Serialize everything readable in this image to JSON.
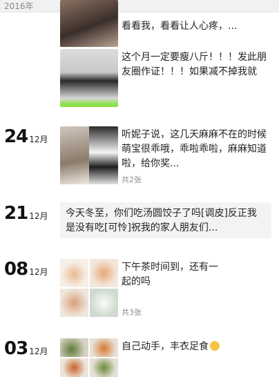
{
  "header": {
    "year": "2016年"
  },
  "posts": [
    {
      "text": "看看我，看看让人心疼，..."
    },
    {
      "text": "这个月一定要瘦八斤！！！发此朋友圈作证！！！如果减不掉我就"
    },
    {
      "day": "24",
      "month": "12月",
      "text": "听妮子说，这几天麻麻不在的时候萌宝很乖哦，乖啦乖啦，麻麻知道啦，给你奖...",
      "count": "共2张"
    },
    {
      "day": "21",
      "month": "12月",
      "text": "今天冬至，你们吃汤圆饺子了吗[调皮]反正我是没有吃[可怜]祝我的家人朋友们..."
    },
    {
      "day": "08",
      "month": "12月",
      "text": "下午茶时间到，还有一起的吗",
      "count": "共3张"
    },
    {
      "day": "03",
      "month": "12月",
      "text": "自己动手，丰衣足食"
    }
  ],
  "colors": {
    "accent": "#111111",
    "muted": "#888888",
    "card_bg": "#f3f3f3"
  }
}
